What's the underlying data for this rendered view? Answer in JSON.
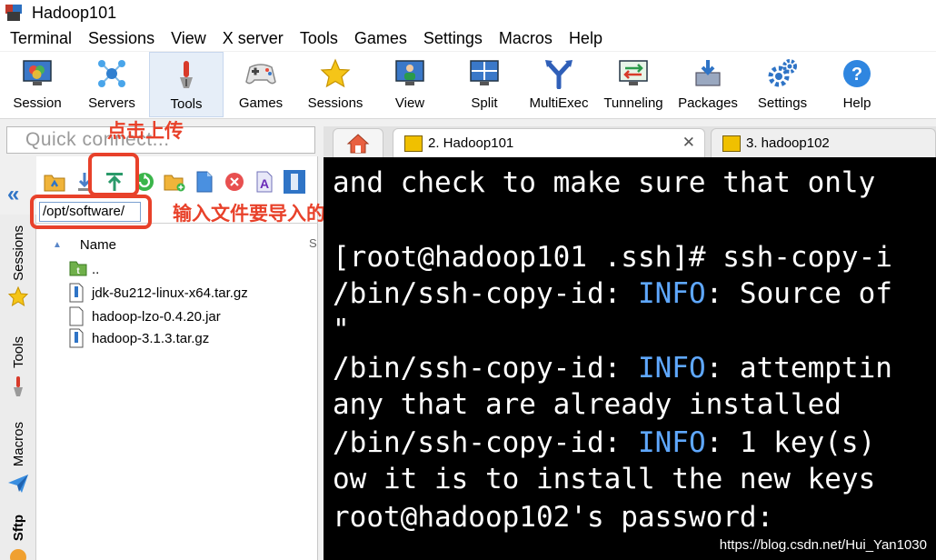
{
  "window": {
    "title": "Hadoop101"
  },
  "menu": [
    "Terminal",
    "Sessions",
    "View",
    "X server",
    "Tools",
    "Games",
    "Settings",
    "Macros",
    "Help"
  ],
  "toolbar": [
    {
      "label": "Session",
      "icon": "session-icon"
    },
    {
      "label": "Servers",
      "icon": "servers-icon"
    },
    {
      "label": "Tools",
      "icon": "tools-icon",
      "active": true
    },
    {
      "label": "Games",
      "icon": "games-icon"
    },
    {
      "label": "Sessions",
      "icon": "sessions-star-icon"
    },
    {
      "label": "View",
      "icon": "view-icon"
    },
    {
      "label": "Split",
      "icon": "split-icon"
    },
    {
      "label": "MultiExec",
      "icon": "multiexec-icon"
    },
    {
      "label": "Tunneling",
      "icon": "tunneling-icon"
    },
    {
      "label": "Packages",
      "icon": "packages-icon"
    },
    {
      "label": "Settings",
      "icon": "settings-icon"
    },
    {
      "label": "Help",
      "icon": "help-icon"
    }
  ],
  "quick_connect": {
    "placeholder": "Quick connect..."
  },
  "side_tabs": [
    "Sessions",
    "Tools",
    "Macros",
    "Sftp"
  ],
  "sftp": {
    "path": "/opt/software/",
    "column_name": "Name",
    "files": [
      {
        "name": "..",
        "type": "parent-folder"
      },
      {
        "name": "jdk-8u212-linux-x64.tar.gz",
        "type": "archive"
      },
      {
        "name": "hadoop-lzo-0.4.20.jar",
        "type": "file"
      },
      {
        "name": "hadoop-3.1.3.tar.gz",
        "type": "archive"
      }
    ]
  },
  "annotations": {
    "upload": "点击上传",
    "path": "输入文件要导入的目录"
  },
  "tabs": [
    {
      "label": "2. Hadoop101",
      "active": true,
      "close": "✕"
    },
    {
      "label": "3. hadoop102",
      "active": false
    }
  ],
  "terminal": {
    "lines": [
      [
        {
          "t": "and check to make sure that only"
        }
      ],
      [
        {
          "t": ""
        }
      ],
      [
        {
          "t": "[root@hadoop101 .ssh]# ssh-copy-i"
        }
      ],
      [
        {
          "t": "/bin/ssh-copy-id: "
        },
        {
          "t": "INFO",
          "c": "info"
        },
        {
          "t": ": Source of"
        }
      ],
      [
        {
          "t": "\""
        }
      ],
      [
        {
          "t": "/bin/ssh-copy-id: "
        },
        {
          "t": "INFO",
          "c": "info"
        },
        {
          "t": ": attemptin"
        }
      ],
      [
        {
          "t": "any that are already installed"
        }
      ],
      [
        {
          "t": "/bin/ssh-copy-id: "
        },
        {
          "t": "INFO",
          "c": "info"
        },
        {
          "t": ": 1 key(s)"
        }
      ],
      [
        {
          "t": "ow it is to install the new keys"
        }
      ],
      [
        {
          "t": "root@hadoop102's password:"
        }
      ]
    ]
  },
  "watermark": "https://blog.csdn.net/Hui_Yan1030",
  "colors": {
    "annotation": "#e8412a",
    "info": "#5fa8ff",
    "terminal_bg": "#000000"
  }
}
